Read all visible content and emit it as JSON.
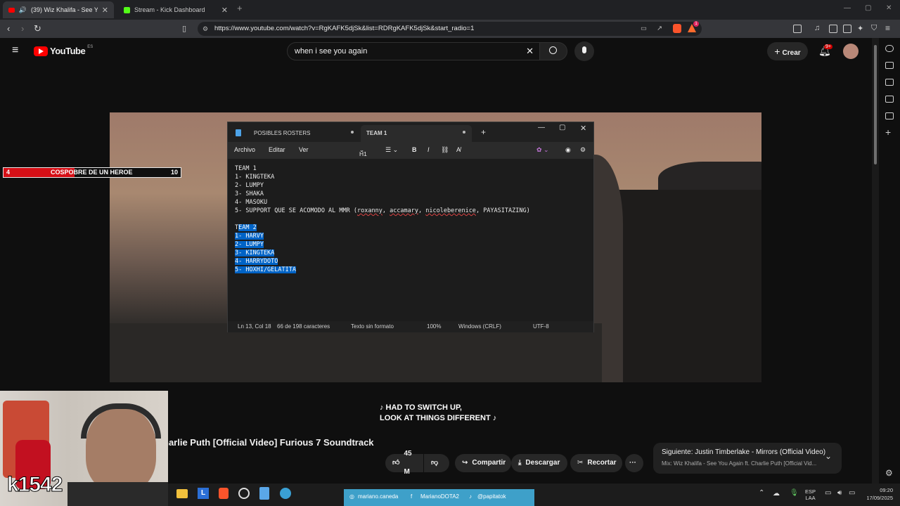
{
  "browser": {
    "tabs": [
      {
        "label": "(39) Wiz Khalifa - See You Ag",
        "active": true
      },
      {
        "label": "Stream - Kick Dashboard",
        "active": false
      }
    ],
    "url": "https://www.youtube.com/watch?v=RgKAFK5djSk&list=RDRgKAFK5djSk&start_radio=1",
    "badge": "1"
  },
  "youtube": {
    "logo_text": "YouTube",
    "region": "ES",
    "search_value": "when i see you again",
    "create_label": "Crear",
    "notif_count": "9+",
    "video_title": "harlie Puth [Official Video] Furious 7 Soundtrack",
    "lyrics_line1": "♪ HAD TO SWITCH UP,",
    "lyrics_line2": "LOOK AT THINGS DIFFERENT ♪",
    "likes": "45 M",
    "share_label": "Compartir",
    "download_label": "Descargar",
    "clip_label": "Recortar",
    "more_label": "···",
    "next_label": "Siguiente: Justin Timberlake - Mirrors (Official Video)",
    "next_sub": "Mix: Wiz Khalifa - See You Again ft. Charlie Puth [Official Vid..."
  },
  "notepad": {
    "tab1": "POSIBLES ROSTERS",
    "tab2": "TEAM 1",
    "menu": [
      "Archivo",
      "Editar",
      "Ver"
    ],
    "heading_btn": "H1",
    "team1_lines": [
      "TEAM 1",
      "1- KINGTEKA",
      "2- LUMPY",
      "3- SHAKA",
      "4- MASOKU"
    ],
    "support_prefix": "5- SUPPORT QUE SE ACOMODO AL MMR (",
    "support_names": [
      "roxanny",
      "accamary",
      "nicoleberenice"
    ],
    "support_suffix": "PAYASITAZING)",
    "team2_first_char": "T",
    "team2_rest": "EAM 2",
    "team2_lines": [
      "1- HARVY",
      "2- LUMPY",
      "3- KINGTEKA",
      "4- HARRYDOTO",
      "5- HOXHI/GELATITA"
    ],
    "status": {
      "position": "Ln 13, Col 18",
      "chars": "66 de 198 caracteres",
      "format": "Texto sin formato",
      "zoom": "100%",
      "eol": "Windows (CRLF)",
      "encoding": "UTF-8"
    }
  },
  "overlay": {
    "left_num": "4",
    "label": "COSPOBRE DE UN HEROE",
    "right_num": "10",
    "progress": 0.4
  },
  "webcam": {
    "handle": "k1542"
  },
  "taskbar": {
    "social": [
      "mariano.caneda",
      "MarianoDOTA2",
      "@papitatok"
    ],
    "lang1": "ESP",
    "lang2": "LAA",
    "time": "09:20",
    "date": "17/09/2025"
  }
}
